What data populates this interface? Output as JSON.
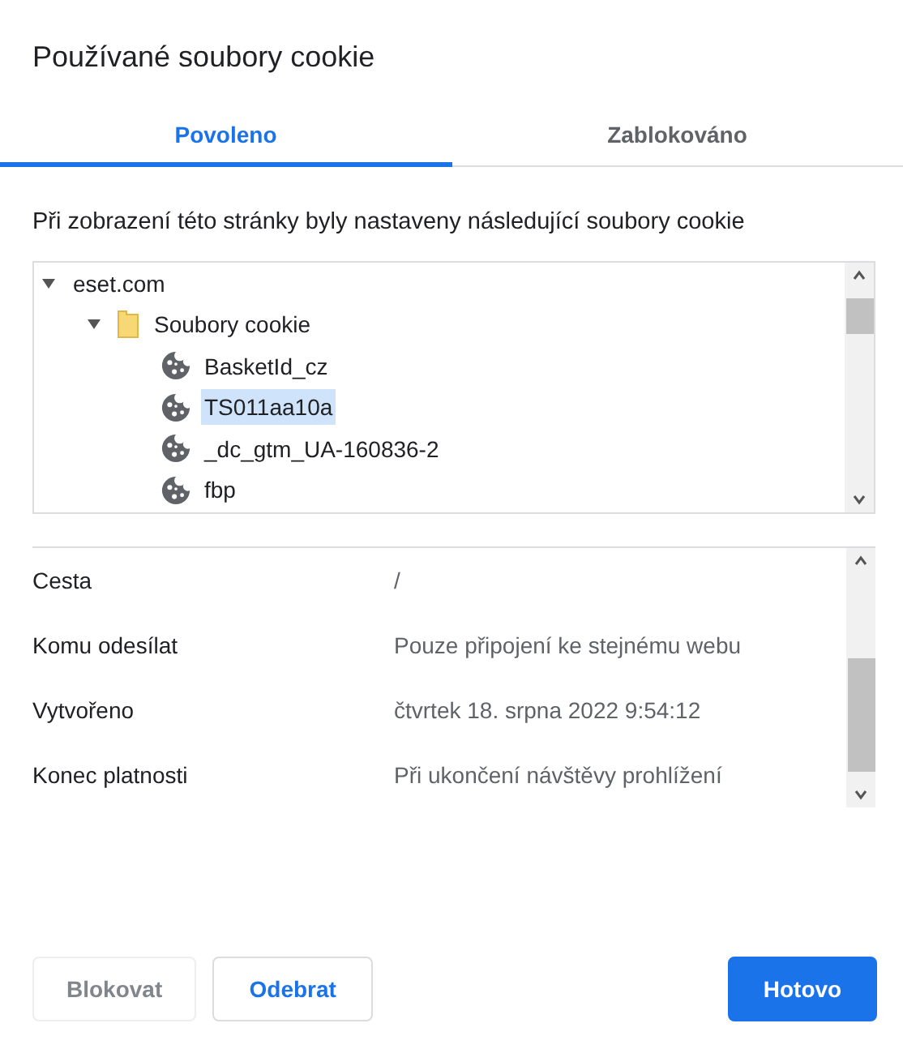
{
  "window": {
    "title": "Používané soubory cookie"
  },
  "tabs": [
    {
      "label": "Povoleno",
      "selected": true
    },
    {
      "label": "Zablokováno",
      "selected": false
    }
  ],
  "description": "Při zobrazení této stránky byly nastaveny následující soubory cookie",
  "tree": [
    {
      "kind": "site",
      "label": "eset.com",
      "expanded": true,
      "children": [
        {
          "kind": "folder",
          "label": "Soubory cookie",
          "expanded": true,
          "children": [
            {
              "kind": "cookie",
              "label": "BasketId_cz",
              "selected": false
            },
            {
              "kind": "cookie",
              "label": "TS011aa10a",
              "selected": true
            },
            {
              "kind": "cookie",
              "label": "_dc_gtm_UA-160836-2",
              "selected": false
            },
            {
              "kind": "cookie",
              "label": "fbp",
              "selected": false
            }
          ]
        }
      ]
    }
  ],
  "details": [
    {
      "label": "Cesta",
      "value": "/"
    },
    {
      "label": "Komu odesílat",
      "value": "Pouze připojení ke stejnému webu"
    },
    {
      "label": "Vytvořeno",
      "value": "čtvrtek 18. srpna 2022 9:54:12"
    },
    {
      "label": "Konec platnosti",
      "value": "Při ukončení návštěvy prohlížení"
    }
  ],
  "buttons": [
    {
      "label": "Blokovat",
      "kind": "secondary",
      "disabled": true
    },
    {
      "label": "Odebrat",
      "kind": "secondary",
      "disabled": false
    },
    {
      "label": "Hotovo",
      "kind": "primary",
      "disabled": false
    }
  ]
}
